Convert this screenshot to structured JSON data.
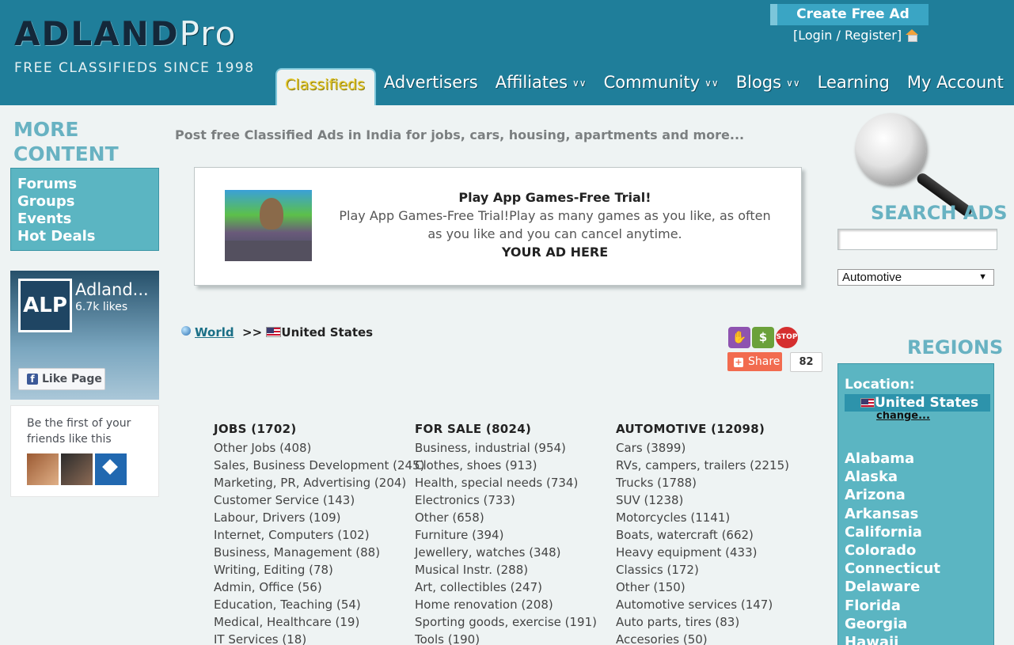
{
  "header": {
    "logo_main": "ADLAND",
    "logo_pro": "Pro",
    "logo_sub": "FREE CLASSIFIEDS SINCE 1998",
    "create_ad": "Create Free Ad",
    "login_text": "[Login / Register]",
    "nav": [
      {
        "label": "Classifieds",
        "active": true,
        "dropdown": false
      },
      {
        "label": "Advertisers",
        "active": false,
        "dropdown": false
      },
      {
        "label": "Affiliates",
        "active": false,
        "dropdown": true
      },
      {
        "label": "Community",
        "active": false,
        "dropdown": true
      },
      {
        "label": "Blogs",
        "active": false,
        "dropdown": true
      },
      {
        "label": "Learning",
        "active": false,
        "dropdown": false
      },
      {
        "label": "My Account",
        "active": false,
        "dropdown": false
      }
    ]
  },
  "left": {
    "more_title_1": "MORE",
    "more_title_2": "CONTENT",
    "links": [
      "Forums",
      "Groups",
      "Events",
      "Hot Deals"
    ],
    "fb": {
      "avatar_text": "ALP",
      "name": "Adland...",
      "likes": "6.7k likes",
      "like_button": "Like Page",
      "friends_text": "Be the first of your friends like this"
    }
  },
  "center": {
    "tagline": "Post free Classified Ads in India for jobs, cars, housing, apartments and more...",
    "ad": {
      "title": "Play App Games-Free Trial!",
      "body": "Play App Games-Free Trial!Play as many games as you like, as often as you like and you can cancel anytime.",
      "cta": "YOUR AD HERE"
    },
    "breadcrumb": {
      "world": "World",
      "sep": ">>",
      "country": "United States"
    },
    "share": {
      "label": "Share",
      "count": "82"
    },
    "categories": [
      {
        "head": "JOBS (1702)",
        "items": [
          "Other Jobs (408)",
          "Sales, Business Development (245)",
          "Marketing, PR, Advertising (204)",
          "Customer Service (143)",
          "Labour, Drivers (109)",
          "Internet, Computers (102)",
          "Business, Management (88)",
          "Writing, Editing (78)",
          "Admin, Office (56)",
          "Education, Teaching (54)",
          "Medical, Healthcare (19)",
          "IT Services (18)"
        ]
      },
      {
        "head": "FOR SALE (8024)",
        "items": [
          "Business, industrial (954)",
          "Clothes, shoes (913)",
          "Health, special needs (734)",
          "Electronics (733)",
          "Other (658)",
          "Furniture (394)",
          "Jewellery, watches (348)",
          "Musical Instr. (288)",
          "Art, collectibles (247)",
          "Home renovation (208)",
          "Sporting goods, exercise (191)",
          "Tools (190)"
        ]
      },
      {
        "head": "AUTOMOTIVE (12098)",
        "items": [
          "Cars (3899)",
          "RVs, campers, trailers (2215)",
          "Trucks (1788)",
          "SUV (1238)",
          "Motorcycles (1141)",
          "Boats, watercraft (662)",
          "Heavy equipment (433)",
          "Classics (172)",
          "Other (150)",
          "Automotive services (147)",
          "Auto parts, tires (83)",
          "Accesories (50)"
        ]
      }
    ]
  },
  "right": {
    "search_title": "SEARCH ADS",
    "search_placeholder": "",
    "select_value": "Automotive",
    "regions_title": "REGIONS",
    "location_label": "Location:",
    "location_current": "United States",
    "change_label": "change...",
    "regions": [
      "Alabama",
      "Alaska",
      "Arizona",
      "Arkansas",
      "California",
      "Colorado",
      "Connecticut",
      "Delaware",
      "Florida",
      "Georgia",
      "Hawaii"
    ]
  },
  "colors": {
    "header_bg": "#1f7e9a",
    "accent_box": "#5bb5c2",
    "title_teal": "#68b2c2",
    "active_tab_text": "#e3c72b",
    "share_btn": "#f26b4f"
  }
}
